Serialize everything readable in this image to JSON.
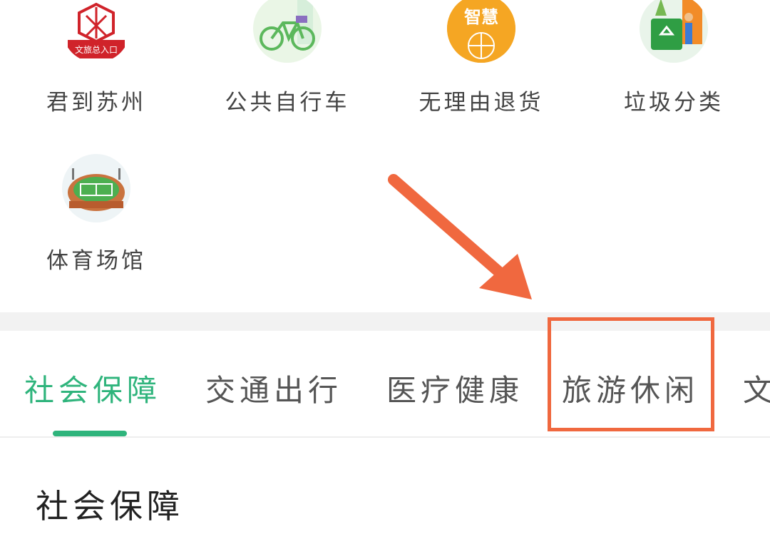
{
  "services": [
    {
      "label": "君到苏州",
      "icon": "tourism-portal-icon",
      "badge": "文旅总入口"
    },
    {
      "label": "公共自行车",
      "icon": "bicycle-icon"
    },
    {
      "label": "无理由退货",
      "icon": "smart-315-icon",
      "badge": "智慧"
    },
    {
      "label": "垃圾分类",
      "icon": "recycle-bin-icon"
    },
    {
      "label": "体育场馆",
      "icon": "stadium-icon"
    }
  ],
  "tabs": [
    {
      "label": "社会保障",
      "active": true
    },
    {
      "label": "交通出行",
      "active": false
    },
    {
      "label": "医疗健康",
      "active": false
    },
    {
      "label": "旅游休闲",
      "active": false
    },
    {
      "label": "文",
      "active": false
    }
  ],
  "section": {
    "title": "社会保障"
  },
  "colors": {
    "accent": "#2fb47c",
    "annotation": "#f0683f"
  }
}
